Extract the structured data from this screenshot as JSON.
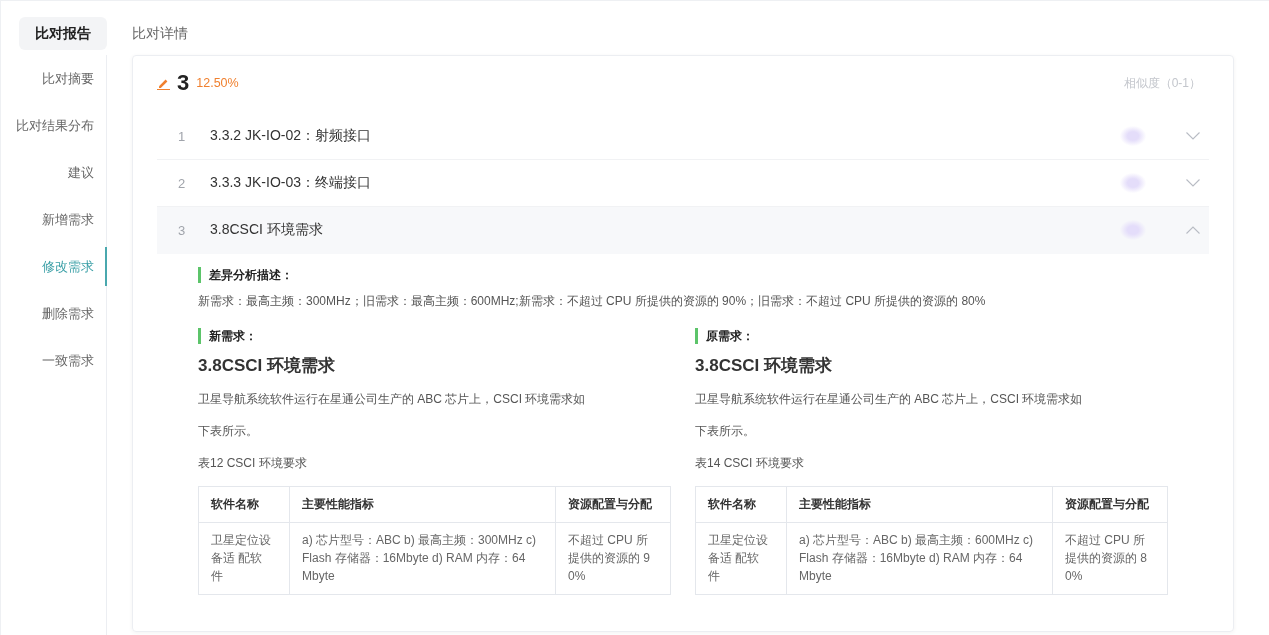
{
  "tabs": [
    {
      "label": "比对报告",
      "selected": true
    },
    {
      "label": "比对详情",
      "selected": false
    }
  ],
  "sidebar": {
    "items": [
      {
        "label": "比对摘要",
        "selected": false
      },
      {
        "label": "比对结果分布",
        "selected": false
      },
      {
        "label": "建议",
        "selected": false
      },
      {
        "label": "新增需求",
        "selected": false
      },
      {
        "label": "修改需求",
        "selected": true
      },
      {
        "label": "删除需求",
        "selected": false
      },
      {
        "label": "一致需求",
        "selected": false
      }
    ]
  },
  "section": {
    "count": "3",
    "percentage": "12.50%",
    "similarity_header": "相似度（0-1）",
    "items": [
      {
        "index": "1",
        "title": "3.3.2 JK-IO-02：射频接口",
        "expanded": false
      },
      {
        "index": "2",
        "title": "3.3.3 JK-IO-03：终端接口",
        "expanded": false
      },
      {
        "index": "3",
        "title": "3.8CSCI 环境需求",
        "expanded": true,
        "detail": {
          "label": "差异分析描述：",
          "text": "新需求：最高主频：300MHz；旧需求：最高主频：600MHz;新需求：不超过 CPU 所提供的资源的 90%；旧需求：不超过 CPU 所提供的资源的 80%",
          "panels": [
            {
              "label": "新需求：",
              "heading": "3.8CSCI 环境需求",
              "paragraphs": [
                "卫星导航系统软件运行在星通公司生产的 ABC 芯片上，CSCI 环境需求如",
                "下表所示。"
              ],
              "caption": "表12 CSCI 环境要求",
              "table": {
                "columns": [
                  "软件名称",
                  "主要性能指标",
                  "资源配置与分配"
                ],
                "rows": [
                  [
                    "卫星定位设备适 配软件",
                    "a) 芯片型号：ABC b) 最高主频：300MHz c) Flash 存储器：16Mbyte d) RAM 内存：64 Mbyte",
                    "不超过 CPU 所提供的资源的 90%"
                  ]
                ]
              }
            },
            {
              "label": "原需求：",
              "heading": "3.8CSCI 环境需求",
              "paragraphs": [
                "卫星导航系统软件运行在星通公司生产的 ABC 芯片上，CSCI 环境需求如",
                "下表所示。"
              ],
              "caption": "表14 CSCI 环境要求",
              "table": {
                "columns": [
                  "软件名称",
                  "主要性能指标",
                  "资源配置与分配"
                ],
                "rows": [
                  [
                    "卫星定位设备适 配软件",
                    "a) 芯片型号：ABC b) 最高主频：600MHz c) Flash 存储器：16Mbyte d) RAM 内存：64 Mbyte",
                    "不超过 CPU 所提供的资源的 80%"
                  ]
                ]
              }
            }
          ]
        }
      }
    ]
  }
}
